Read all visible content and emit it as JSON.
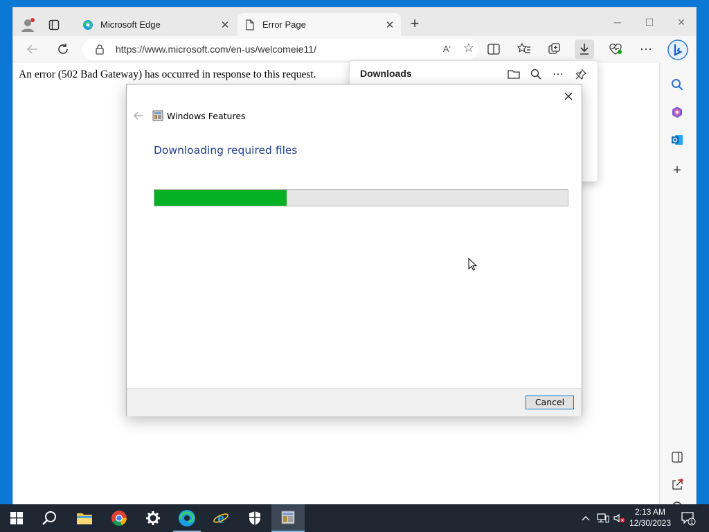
{
  "browser": {
    "tabs": [
      {
        "label": "Microsoft Edge",
        "icon": "edge-logo-icon",
        "active": false
      },
      {
        "label": "Error Page",
        "icon": "page-icon",
        "active": true
      }
    ],
    "address_url": "https://www.microsoft.com/en-us/welcomeie11/",
    "read_aloud_label": "Aʹ"
  },
  "page": {
    "error_message": "An error (502 Bad Gateway) has occurred in response to this request."
  },
  "downloads": {
    "title": "Downloads"
  },
  "dialog": {
    "app_name": "Windows Features",
    "heading": "Downloading required files",
    "progress_fraction": 0.32,
    "cancel_label": "Cancel"
  },
  "taskbar": {
    "time": "2:13 AM",
    "date": "12/30/2023",
    "notification_count": "1"
  },
  "colors": {
    "progress_green": "#06b025",
    "desktop_blue": "#0a78d4",
    "dialog_heading": "#1e3f8c"
  }
}
